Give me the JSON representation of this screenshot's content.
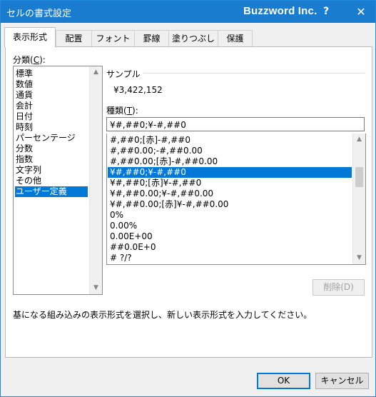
{
  "window": {
    "title": "セルの書式設定",
    "brand": "Buzzword Inc.",
    "help_glyph": "?",
    "close_glyph": "✕"
  },
  "tabs": [
    {
      "label": "表示形式",
      "active": true
    },
    {
      "label": "配置"
    },
    {
      "label": "フォント"
    },
    {
      "label": "罫線"
    },
    {
      "label": "塗りつぶし"
    },
    {
      "label": "保護"
    }
  ],
  "category": {
    "label_prefix": "分類(",
    "label_key": "C",
    "label_suffix": "):",
    "items": [
      "標準",
      "数値",
      "通貨",
      "会計",
      "日付",
      "時刻",
      "パーセンテージ",
      "分数",
      "指数",
      "文字列",
      "その他",
      "ユーザー定義"
    ],
    "selected_index": 11
  },
  "sample": {
    "label": "サンプル",
    "value": "¥3,422,152"
  },
  "type": {
    "label_prefix": "種類(",
    "label_key": "T",
    "label_suffix": "):",
    "value": "¥#,##0;¥-#,##0",
    "formats": [
      "#,##0;[赤]-#,##0",
      "#,##0.00;-#,##0.00",
      "#,##0.00;[赤]-#,##0.00",
      "¥#,##0;¥-#,##0",
      "¥#,##0;[赤]¥-#,##0",
      "¥#,##0.00;¥-#,##0.00",
      "¥#,##0.00;[赤]¥-#,##0.00",
      "0%",
      "0.00%",
      "0.00E+00",
      "##0.0E+0",
      "# ?/?"
    ],
    "selected_index": 3
  },
  "delete_button": "削除(D)",
  "description": "基になる組み込みの表示形式を選択し、新しい表示形式を入力してください。",
  "ok_button": "OK",
  "cancel_button": "キャンセル",
  "icons": {
    "scroll_up": "▲",
    "scroll_down": "▼"
  },
  "colors": {
    "titlebar": "#1a7ccf",
    "selection": "#0078d7"
  }
}
